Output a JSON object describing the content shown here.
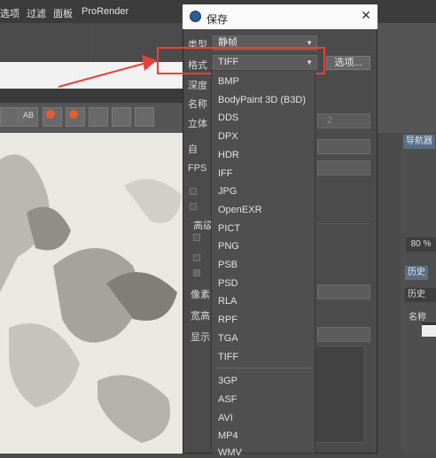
{
  "menubar": {
    "items": [
      "选项",
      "过滤",
      "面板",
      "ProRender"
    ]
  },
  "toolbar": {
    "ab_label": "AB"
  },
  "dialog": {
    "title": "保存",
    "fields": {
      "type_label": "类型",
      "type_value": "静帧",
      "format_label": "格式",
      "format_value": "TIFF",
      "options_button": "选项...",
      "depth_label": "深度",
      "name_label": "名称",
      "stereo_label": "立体",
      "stereo_value": "2",
      "auto_label": "自",
      "fps_label": "FPS",
      "advanced_label": "高级",
      "pixel_label": "像素",
      "aspect_label": "宽高",
      "display_label": "显示"
    },
    "format_options": [
      "BMP",
      "BodyPaint 3D (B3D)",
      "DDS",
      "DPX",
      "HDR",
      "IFF",
      "JPG",
      "OpenEXR",
      "PICT",
      "PNG",
      "PSB",
      "PSD",
      "RLA",
      "RPF",
      "TGA",
      "TIFF",
      "3GP",
      "ASF",
      "AVI",
      "MP4",
      "WMV"
    ]
  },
  "right_panel": {
    "navigator_tab": "导航器",
    "zoom": "80 %",
    "history_tab": "历史",
    "history_select": "历史",
    "name_header": "名称"
  },
  "colors": {
    "highlight": "#e8413a",
    "tab_accent": "#5a6e86"
  }
}
